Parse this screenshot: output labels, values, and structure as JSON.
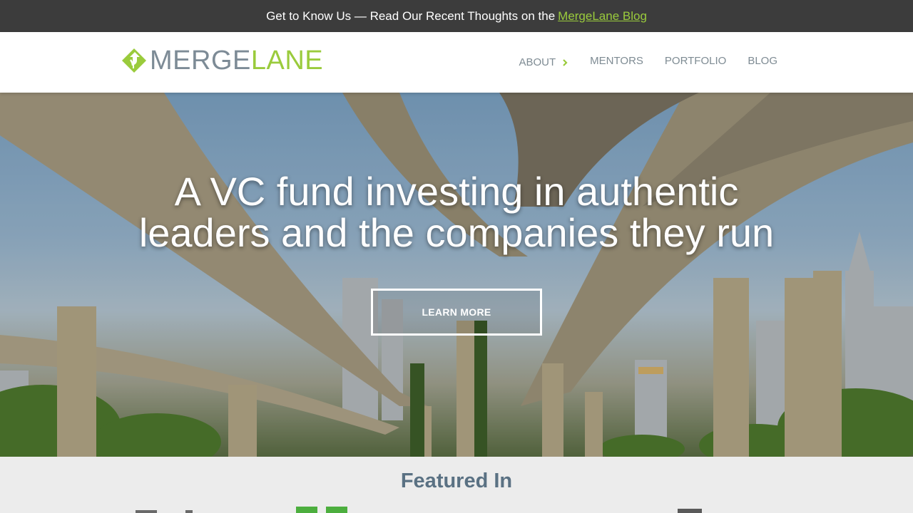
{
  "announcement": {
    "text": "Get to Know Us — Read Our Recent Thoughts on the",
    "link_text": "MergeLane Blog"
  },
  "brand": {
    "name_part1": "MERGE",
    "name_part2": "LANE",
    "accent_color": "#9acb3c",
    "gray_color": "#7d8b96"
  },
  "nav": {
    "items": [
      {
        "label": "ABOUT",
        "icon": "chevron-right-icon"
      },
      {
        "label": "MENTORS"
      },
      {
        "label": "PORTFOLIO"
      },
      {
        "label": "BLOG"
      }
    ]
  },
  "hero": {
    "title_line1": "A VC fund investing in authentic",
    "title_line2": "leaders and the companies they run",
    "button_label": "LEARN MORE"
  },
  "featured": {
    "title": "Featured In"
  }
}
